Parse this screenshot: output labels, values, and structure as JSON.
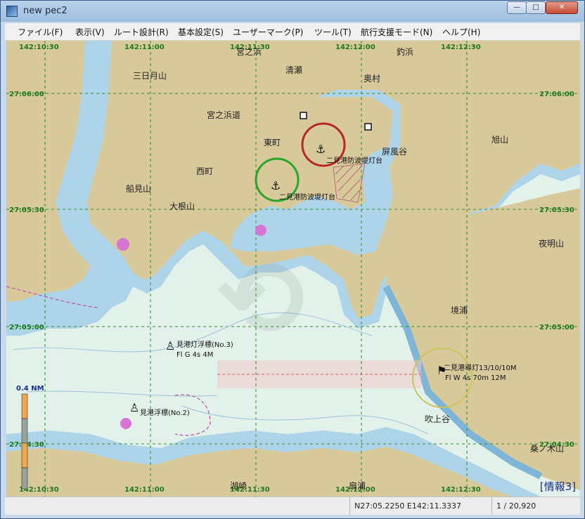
{
  "window": {
    "title": "new pec2",
    "minimize_glyph": "—",
    "maximize_glyph": "□",
    "close_glyph": "✕"
  },
  "menu": [
    {
      "label": "ファイル(F)"
    },
    {
      "label": "表示(V)"
    },
    {
      "label": "ルート設計(R)"
    },
    {
      "label": "基本設定(S)"
    },
    {
      "label": "ユーザーマーク(P)"
    },
    {
      "label": "ツール(T)"
    },
    {
      "label": "航行支援モード(N)"
    },
    {
      "label": "ヘルプ(H)"
    }
  ],
  "map": {
    "grid_labels_top": [
      "142:10:30",
      "142:11:00",
      "142:11:30",
      "142:12:00",
      "142:12:30"
    ],
    "grid_labels_bottom": [
      "142:10:30",
      "142:11:00",
      "142:11:30",
      "142:12:00",
      "142:12:30"
    ],
    "grid_labels_left": [
      "27:06:00",
      "27:05:30",
      "27:05:00",
      "27:04:30"
    ],
    "grid_labels_right": [
      "27:06:00",
      "27:05:30",
      "27:05:00",
      "27:04:30"
    ],
    "place_names": [
      "宮之浜",
      "釣浜",
      "清瀬",
      "奥村",
      "三日月山",
      "宮之浜道",
      "東町",
      "屏風谷",
      "旭山",
      "西町",
      "船見山",
      "大根山",
      "夜明山",
      "境浦",
      "吹上谷",
      "桑ノ木山",
      "湖崎",
      "扇浦"
    ],
    "aids_to_navigation": [
      {
        "name": "二見港防波堤灯台"
      },
      {
        "name": "二見港防波堤灯台"
      },
      {
        "name": "見港灯浮標(No.3)",
        "light": "Fl G 4s 4M"
      },
      {
        "name": "見港浮標(No.2)"
      },
      {
        "name": "二見港導灯13/10/10M",
        "light": "Fl W 4s 70m 12M"
      }
    ],
    "scale_label": "0.4 NM",
    "info_label": "[情報3]",
    "colors": {
      "land": "#d8c99a",
      "shallow_water": "#aed4ea",
      "deep_water": "#e2f2ea",
      "grid_line": "#2d8a2d",
      "grid_label": "#1d7a1d",
      "danger_circle": "#b8262a",
      "green_circle": "#2aa52a",
      "yellow_circle": "#c9c55a"
    }
  },
  "status": {
    "coordinates": "N27:05.2250 E142:11.3337",
    "scale": "1 / 20,920"
  }
}
